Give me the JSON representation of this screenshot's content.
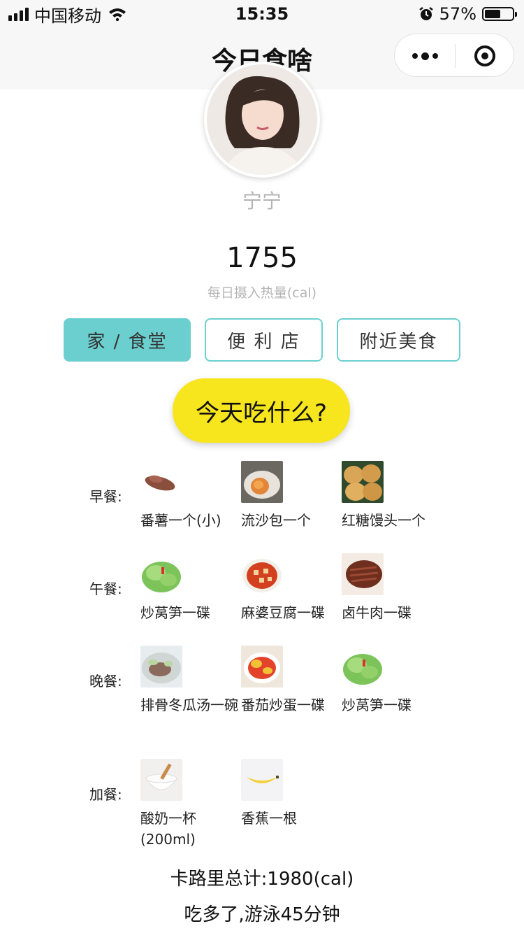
{
  "status_bar": {
    "carrier": "中国移动",
    "time": "15:35",
    "battery_percent": "57%",
    "battery_level": 0.57,
    "icons": [
      "signal-icon",
      "wifi-icon",
      "alarm-icon",
      "battery-icon"
    ]
  },
  "nav": {
    "title": "今日食啥",
    "more_icon": "more-dots-icon",
    "close_icon": "target-close-icon"
  },
  "profile": {
    "name": "宁宁",
    "calories": "1755",
    "calories_label": "每日摄入热量(cal)"
  },
  "options": [
    {
      "label": "家 / 食堂",
      "active": true
    },
    {
      "label": "便 利 店",
      "active": false
    },
    {
      "label": "附近美食",
      "active": false
    }
  ],
  "go_button": "今天吃什么?",
  "meals": [
    {
      "label": "早餐:",
      "items": [
        {
          "name": "番薯一个(小)",
          "icon": "sweet-potato-icon"
        },
        {
          "name": "流沙包一个",
          "icon": "custard-bun-icon"
        },
        {
          "name": "红糖馒头一个",
          "icon": "brown-sugar-bun-icon"
        }
      ]
    },
    {
      "label": "午餐:",
      "items": [
        {
          "name": "炒莴笋一碟",
          "icon": "lettuce-icon"
        },
        {
          "name": "麻婆豆腐一碟",
          "icon": "mapo-tofu-icon"
        },
        {
          "name": "卤牛肉一碟",
          "icon": "braised-beef-icon"
        }
      ]
    },
    {
      "label": "晚餐:",
      "items": [
        {
          "name": "排骨冬瓜汤一碗",
          "icon": "rib-soup-icon"
        },
        {
          "name": "番茄炒蛋一碟",
          "icon": "tomato-egg-icon"
        },
        {
          "name": "炒莴笋一碟",
          "icon": "lettuce-icon"
        }
      ]
    },
    {
      "label": "加餐:",
      "items": [
        {
          "name": "酸奶一杯(200ml)",
          "icon": "yogurt-icon"
        },
        {
          "name": "香蕉一根",
          "icon": "banana-icon"
        }
      ]
    }
  ],
  "total": "卡路里总计:1980(cal)",
  "advice": "吃多了,游泳45分钟"
}
